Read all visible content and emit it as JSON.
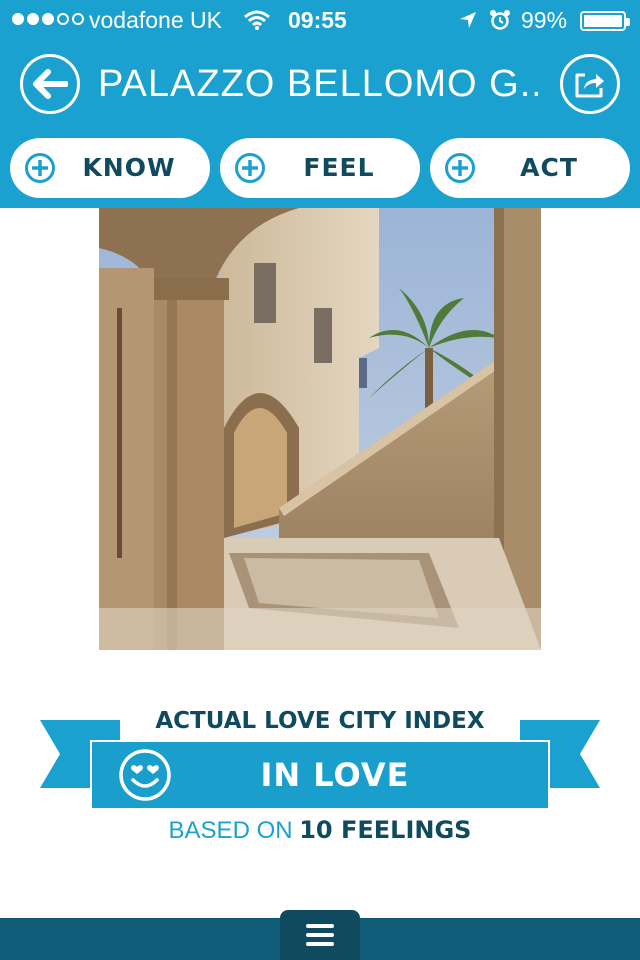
{
  "status_bar": {
    "carrier": "vodafone UK",
    "time": "09:55",
    "battery": "99%",
    "signal_bars_filled": 3,
    "signal_bars_total": 5
  },
  "header": {
    "title": "PALAZZO BELLOMO G...",
    "back_icon": "back-arrow-icon",
    "share_icon": "share-icon"
  },
  "tabs": [
    {
      "label": "KNOW",
      "icon": "plus-circle-icon"
    },
    {
      "label": "FEEL",
      "icon": "plus-circle-icon"
    },
    {
      "label": "ACT",
      "icon": "plus-circle-icon"
    }
  ],
  "love_index": {
    "heading": "ACTUAL LOVE CITY INDEX",
    "status": "IN LOVE",
    "icon": "heart-eyes-smiley-icon",
    "based_on_label": "BASED ON",
    "feelings_count": "10 FEELINGS"
  },
  "colors": {
    "primary": "#1ba1cf",
    "dark": "#0f4a5e",
    "bottom_bar": "#0f5b78"
  },
  "bottom_bar": {
    "menu_icon": "hamburger-menu-icon"
  }
}
